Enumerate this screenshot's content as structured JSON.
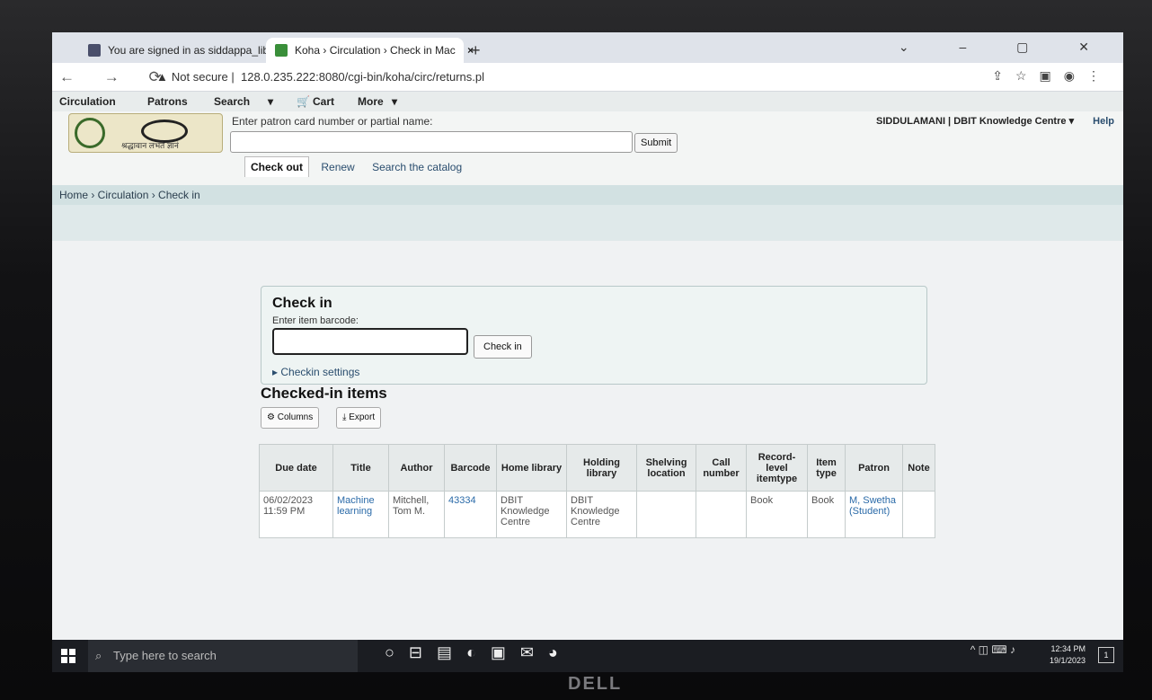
{
  "browser": {
    "tabs": [
      {
        "title": "You are signed in as siddappa_lib",
        "close": "×"
      },
      {
        "title": "Koha › Circulation › Check in Mac",
        "close": "×"
      }
    ],
    "new_tab": "+",
    "security": "Not secure",
    "url": "128.0.235.222:8080/cgi-bin/koha/circ/returns.pl"
  },
  "koha_nav": {
    "items": [
      "Circulation",
      "Patrons",
      "Search",
      "Cart",
      "More"
    ]
  },
  "header": {
    "patron_label": "Enter patron card number or partial name:",
    "submit_label": "Submit",
    "mode_tabs": [
      "Check out",
      "Renew",
      "Search the catalog"
    ],
    "user": "SIDDULAMANI",
    "library": "DBIT Knowledge Centre",
    "help": "Help",
    "logo_motto": "श्रद्धावान लभते ज्ञानं"
  },
  "breadcrumb": "Home › Circulation › Check in",
  "checkin": {
    "title": "Check in",
    "barcode_label": "Enter item barcode:",
    "button_label": "Check in",
    "settings_link": "Checkin settings"
  },
  "checked_in": {
    "title": "Checked-in items",
    "columns_label": "Columns",
    "export_label": "Export",
    "headers": [
      "Due date",
      "Title",
      "Author",
      "Barcode",
      "Home library",
      "Holding library",
      "Shelving location",
      "Call number",
      "Record-level itemtype",
      "Item type",
      "Patron",
      "Note"
    ],
    "rows": [
      [
        "06/02/2023 11:59 PM",
        "Machine learning",
        "Mitchell, Tom M.",
        "43334",
        "DBIT Knowledge Centre",
        "DBIT Knowledge Centre",
        "",
        "",
        "Book",
        "Book",
        "M, Swetha (Student)",
        ""
      ]
    ]
  },
  "taskbar": {
    "search_placeholder": "Type here to search",
    "time": "12:34 PM",
    "date": "19/1/2023",
    "notifications": "1"
  },
  "monitor_brand": "DELL"
}
